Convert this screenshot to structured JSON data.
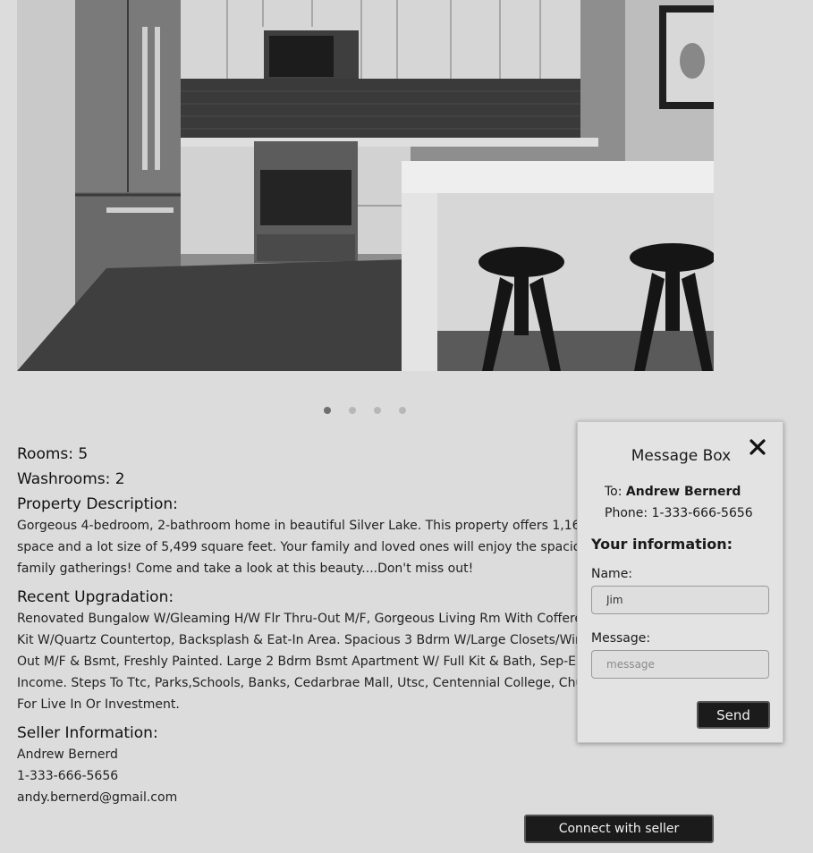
{
  "listing": {
    "rooms_line": "Rooms: 5",
    "washrooms_line": "Washrooms: 2",
    "description_title": "Property Description:",
    "description_lines": [
      "Gorgeous 4-bedroom, 2-bathroom home in beautiful Silver Lake. This property offers 1,160 sq",
      "space and a lot size of 5,499 square feet. Your family and loved ones will enjoy the spacious ba",
      "family gatherings! Come and take a look at this beauty....Don't miss out!"
    ],
    "upgrades_title": "Recent Upgradation:",
    "upgrades_lines": [
      "Renovated Bungalow W/Gleaming H/W Flr Thru-Out M/F, Gorgeous Living Rm With Coffered",
      "Kit W/Quartz Countertop, Backsplash & Eat-In Area. Spacious 3 Bdrm W/Large Closets/Windo",
      "Out M/F & Bsmt, Freshly Painted. Large 2 Bdrm Bsmt Apartment W/ Full Kit & Bath, Sep-Ent.",
      "Income. Steps To Ttc, Parks,Schools, Banks, Cedarbrae Mall, Utsc, Centennial College, Church,N",
      "For Live In Or Investment."
    ],
    "seller_title": "Seller Information:",
    "seller_name": "Andrew Bernerd",
    "seller_phone": "1-333-666-5656",
    "seller_email": "andy.bernerd@gmail.com"
  },
  "gallery": {
    "icon": "kitchen-photo",
    "dot_count": 4,
    "active_dot": 0
  },
  "connect_button": "Connect with seller",
  "message_box": {
    "title": "Message Box",
    "to_label": "To:",
    "to_name": "Andrew Bernerd",
    "phone_line": "Phone: 1-333-666-5656",
    "your_info": "Your information:",
    "name_label": "Name:",
    "name_value": "Jim",
    "message_label": "Message:",
    "message_placeholder": "message",
    "send_label": "Send"
  },
  "colors": {
    "background": "#dcdcdc",
    "button": "#1b1b1b",
    "button_text": "#f2f2f2"
  }
}
